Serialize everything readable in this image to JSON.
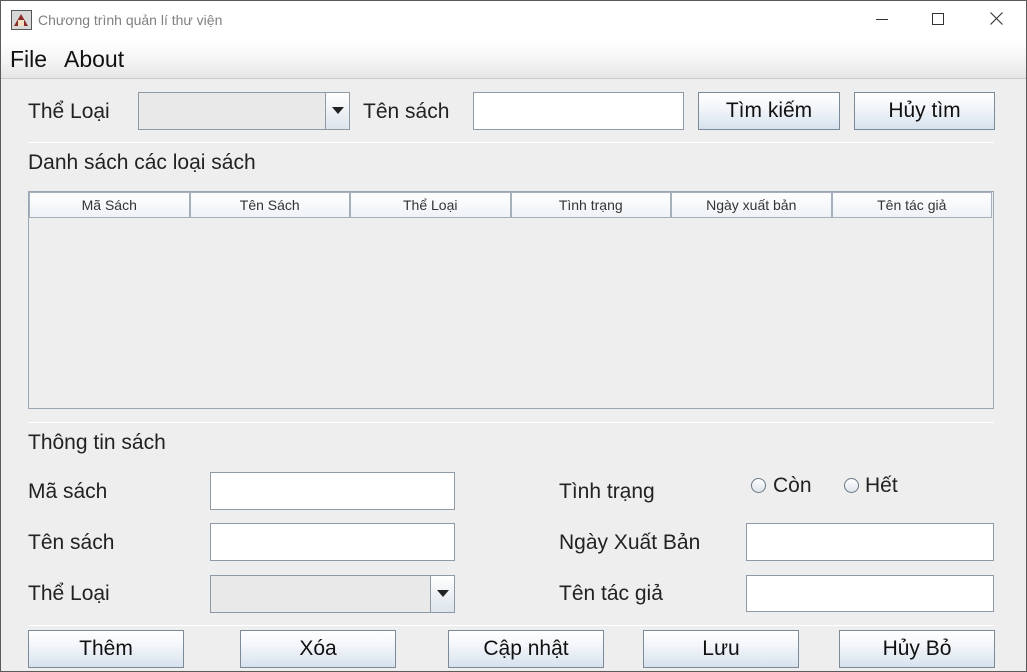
{
  "window": {
    "title": "Chương trình quản lí thư viện"
  },
  "menu": {
    "items": [
      "File",
      "About"
    ]
  },
  "search": {
    "category_label": "Thể Loại",
    "category_value": "",
    "name_label": "Tên sách",
    "name_value": "",
    "search_button": "Tìm kiếm",
    "cancel_button": "Hủy tìm"
  },
  "list": {
    "title": "Danh sách các loại sách",
    "columns": [
      "Mã Sách",
      "Tên Sách",
      "Thể Loại",
      "Tình trạng",
      "Ngày xuất bản",
      "Tên tác giả"
    ],
    "rows": []
  },
  "details": {
    "title": "Thông tin sách",
    "id_label": "Mã sách",
    "id_value": "",
    "name_label": "Tên sách",
    "name_value": "",
    "category_label": "Thể Loại",
    "category_value": "",
    "status_label": "Tình trạng",
    "status_options": [
      "Còn",
      "Hết"
    ],
    "date_label": "Ngày Xuất Bản",
    "date_value": "",
    "author_label": "Tên tác giả",
    "author_value": ""
  },
  "actions": {
    "add": "Thêm",
    "delete": "Xóa",
    "update": "Cập nhật",
    "save": "Lưu",
    "cancel": "Hủy Bỏ"
  }
}
